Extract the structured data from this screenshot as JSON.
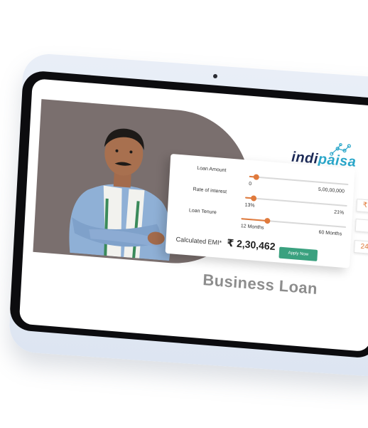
{
  "brand": {
    "logo_part1": "indi",
    "logo_part2": "paisa"
  },
  "calculator": {
    "loan_amount": {
      "label": "Loan Amount",
      "min_label": "0",
      "max_label": "5,00,00,000",
      "value_fraction": 0.07
    },
    "interest": {
      "label": "Rate of interest",
      "min_label": "13%",
      "max_label": "21%",
      "value_fraction": 0.08
    },
    "tenure": {
      "label": "Loan Tenure",
      "min_label": "12 Months",
      "max_label": "60 Months",
      "value_fraction": 0.25
    },
    "emi_label": "Calculated EMI*",
    "emi_value": "₹ 2,30,462",
    "apply_label": "Apply Now",
    "side_values": [
      "₹",
      "",
      "24"
    ]
  },
  "headline": "Business Loan",
  "colors": {
    "accent": "#e07a3c",
    "button": "#3aa17f",
    "logo_blue": "#1c2a57",
    "logo_cyan": "#2aa6c9",
    "banner": "#7a6f6e"
  }
}
